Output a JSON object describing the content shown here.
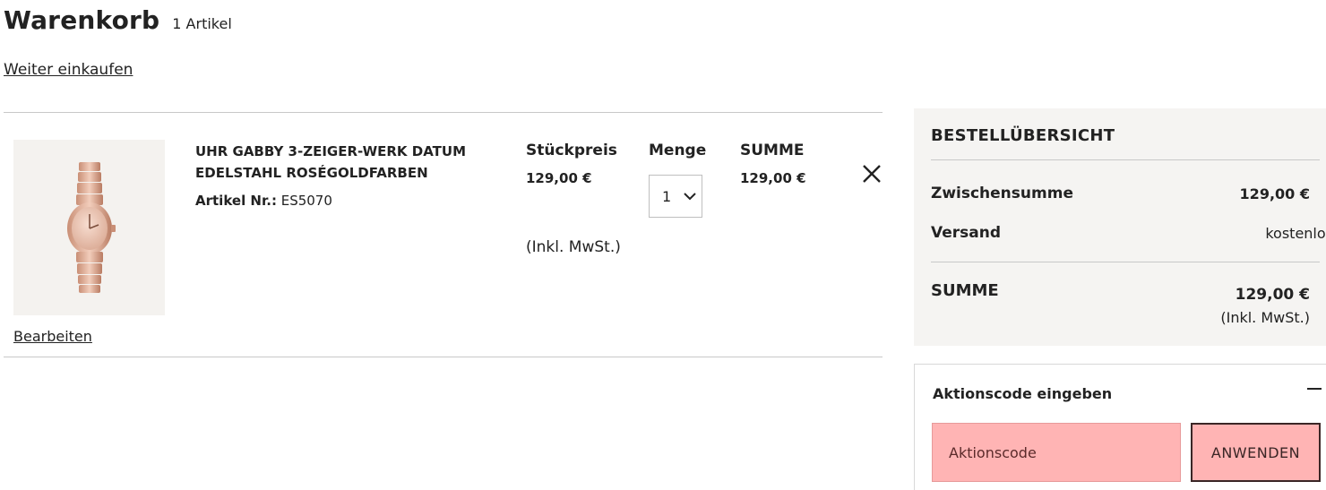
{
  "header": {
    "title": "Warenkorb",
    "item_count": "1 Artikel",
    "continue_link": "Weiter einkaufen"
  },
  "cart": {
    "columns": {
      "unit_price": "Stückpreis",
      "quantity": "Menge",
      "total": "SUMME"
    },
    "item": {
      "name": "UHR GABBY 3-ZEIGER-WERK DATUM EDELSTAHL ROSÉGOLDFARBEN",
      "article_label": "Artikel Nr.:",
      "article_number": "ES5070",
      "unit_price": "129,00 €",
      "quantity": "1",
      "total": "129,00 €",
      "tax_note": "(Inkl. MwSt.)",
      "edit_link": "Bearbeiten",
      "image_icon": "watch-product-image",
      "remove_icon": "close-icon"
    }
  },
  "summary": {
    "title": "BESTELLÜBERSICHT",
    "subtotal_label": "Zwischensumme",
    "subtotal_value": "129,00 €",
    "shipping_label": "Versand",
    "shipping_value": "kostenlos",
    "total_label": "SUMME",
    "total_value": "129,00 €",
    "total_tax_note": "(Inkl. MwSt.)"
  },
  "promo": {
    "title": "Aktionscode eingeben",
    "toggle_icon": "minus-icon",
    "input_placeholder": "Aktionscode",
    "apply_label": "ANWENDEN"
  },
  "colors": {
    "text": "#222222",
    "summary_background": "#f5f4f2",
    "highlight": "#ffb4b4",
    "divider": "#c8c8c8"
  }
}
